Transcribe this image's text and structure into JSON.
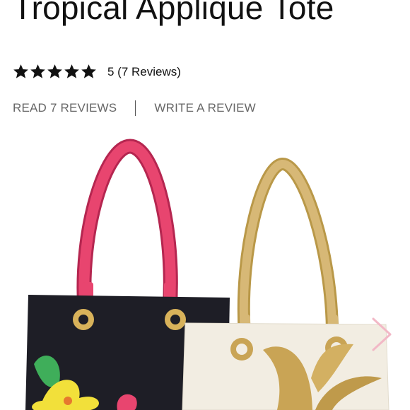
{
  "product": {
    "title": "Tropical Applique Tote"
  },
  "rating": {
    "stars": 5,
    "max_stars": 5,
    "summary": "5 (7 Reviews)",
    "star_color": "#111111"
  },
  "reviews": {
    "read_label": "READ 7 REVIEWS",
    "write_label": "WRITE A REVIEW"
  },
  "gallery": {
    "next_icon": "chevron-right-icon",
    "arrow_color": "#f2b8c6",
    "colors": {
      "black_tote": "#1e1e26",
      "pink_handle": "#e8456f",
      "cream_tote": "#f2ede2",
      "tan_handle": "#d7b876",
      "gold_applique": "#c9a455",
      "yellow_flower": "#f2e03a",
      "green_leaf": "#3fae5a"
    }
  }
}
